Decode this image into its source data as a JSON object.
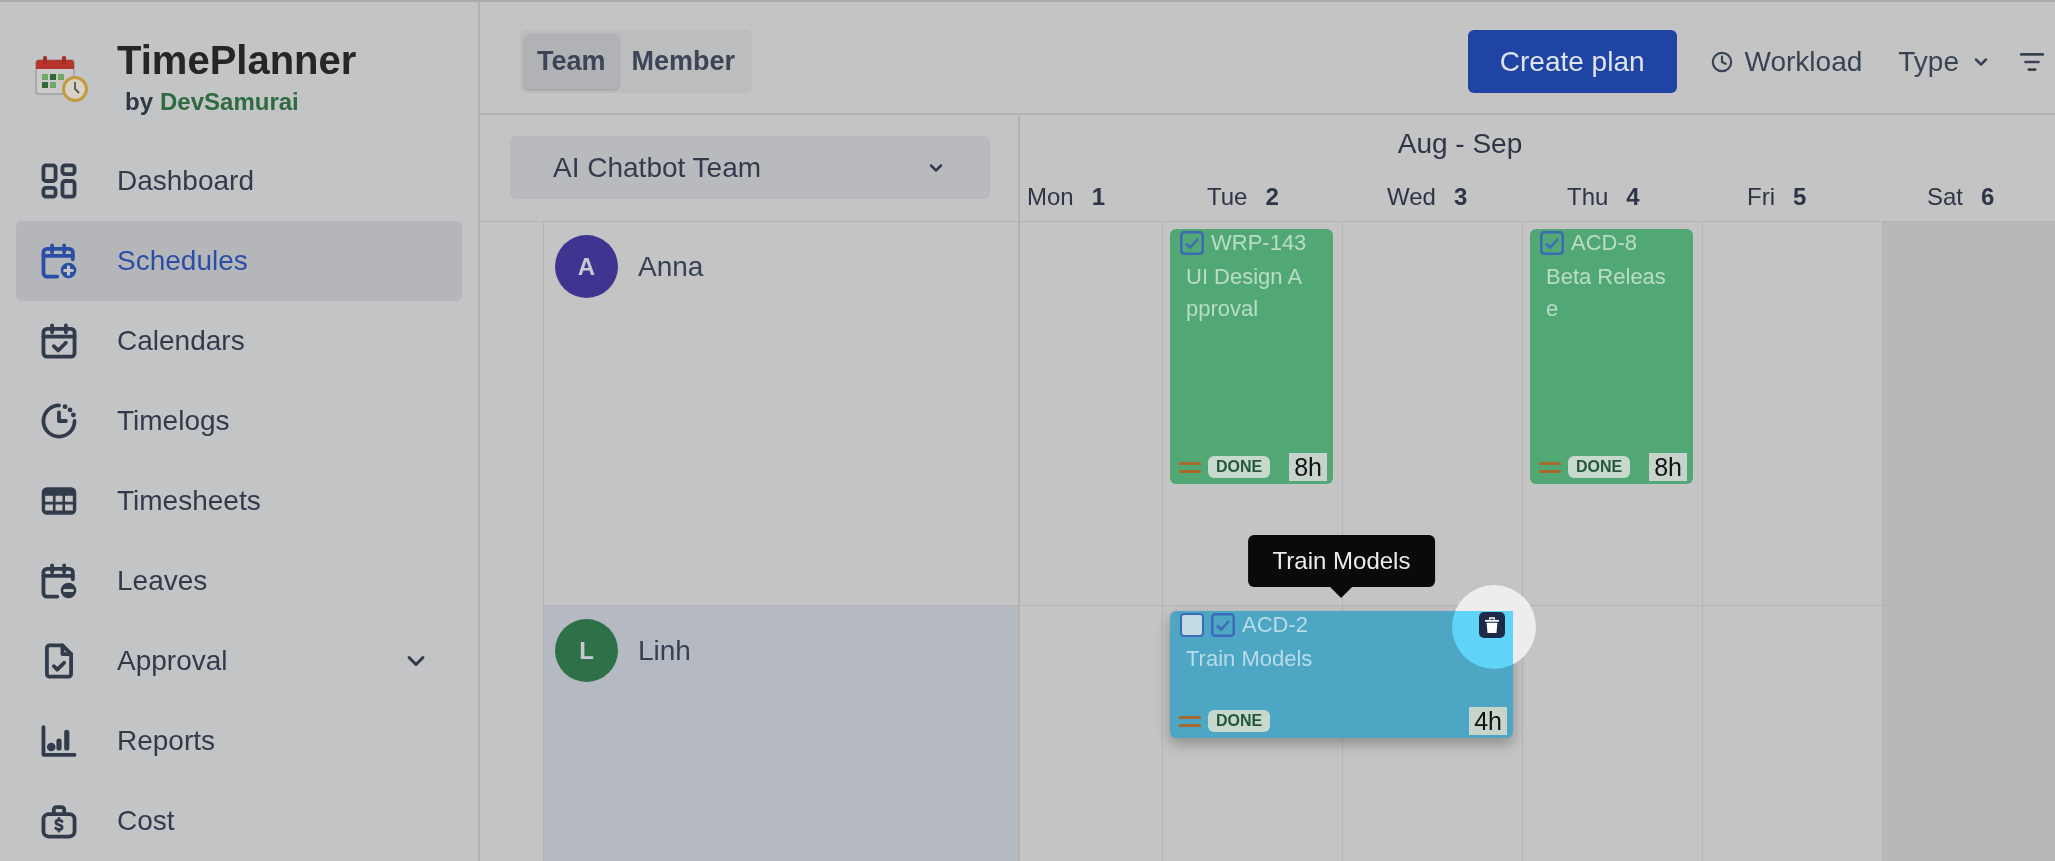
{
  "app": {
    "name": "TimePlanner",
    "by": "by",
    "vendor": "DevSamurai"
  },
  "sidebar": {
    "items": [
      {
        "label": "Dashboard",
        "selected": false,
        "expandable": false
      },
      {
        "label": "Schedules",
        "selected": true,
        "expandable": false
      },
      {
        "label": "Calendars",
        "selected": false,
        "expandable": false
      },
      {
        "label": "Timelogs",
        "selected": false,
        "expandable": false
      },
      {
        "label": "Timesheets",
        "selected": false,
        "expandable": false
      },
      {
        "label": "Leaves",
        "selected": false,
        "expandable": false
      },
      {
        "label": "Approval",
        "selected": false,
        "expandable": true
      },
      {
        "label": "Reports",
        "selected": false,
        "expandable": false
      },
      {
        "label": "Cost",
        "selected": false,
        "expandable": false
      }
    ]
  },
  "view_switch": [
    {
      "label": "Team",
      "selected": true
    },
    {
      "label": "Member",
      "selected": false
    }
  ],
  "toolbar": {
    "create_button": "Create plan",
    "workload_button": "Workload",
    "type_dropdown": "Type"
  },
  "team_select": {
    "value": "AI Chatbot Team"
  },
  "calendar": {
    "range": "Aug - Sep",
    "days": [
      {
        "name": "Mon",
        "date": "1",
        "weekend": false
      },
      {
        "name": "Tue",
        "date": "2",
        "weekend": false
      },
      {
        "name": "Wed",
        "date": "3",
        "weekend": false
      },
      {
        "name": "Thu",
        "date": "4",
        "weekend": false
      },
      {
        "name": "Fri",
        "date": "5",
        "weekend": false
      },
      {
        "name": "Sat",
        "date": "6",
        "weekend": true
      }
    ]
  },
  "members": [
    {
      "initial": "A",
      "name": "Anna",
      "color": "#3f3590",
      "hovered": false,
      "slots": [
        {
          "kind": "empty"
        },
        {
          "kind": "tall",
          "key": "WRP-143",
          "title": "UI Design Approval",
          "status": "DONE",
          "hours": "8h",
          "color": "#51a874",
          "hovered": false,
          "spotlight": false
        },
        {
          "kind": "empty"
        },
        {
          "kind": "tall",
          "key": "ACD-8",
          "title": "Beta Release",
          "status": "DONE",
          "hours": "8h",
          "color": "#51a874",
          "hovered": false,
          "spotlight": false
        },
        {
          "kind": "empty"
        },
        {
          "kind": "empty"
        }
      ]
    },
    {
      "initial": "L",
      "name": "Linh",
      "color": "#2e7048",
      "hovered": true,
      "slots": [
        {
          "kind": "empty"
        },
        {
          "kind": "wide",
          "key": "ACD-2",
          "title": "Train Models",
          "status": "DONE",
          "hours": "4h",
          "color": "#4ca6c4",
          "hovered": true,
          "checked": false,
          "tooltip": "Train Models",
          "spotlight": true
        },
        {
          "kind": "empty"
        },
        {
          "kind": "empty"
        },
        {
          "kind": "empty"
        }
      ]
    }
  ]
}
